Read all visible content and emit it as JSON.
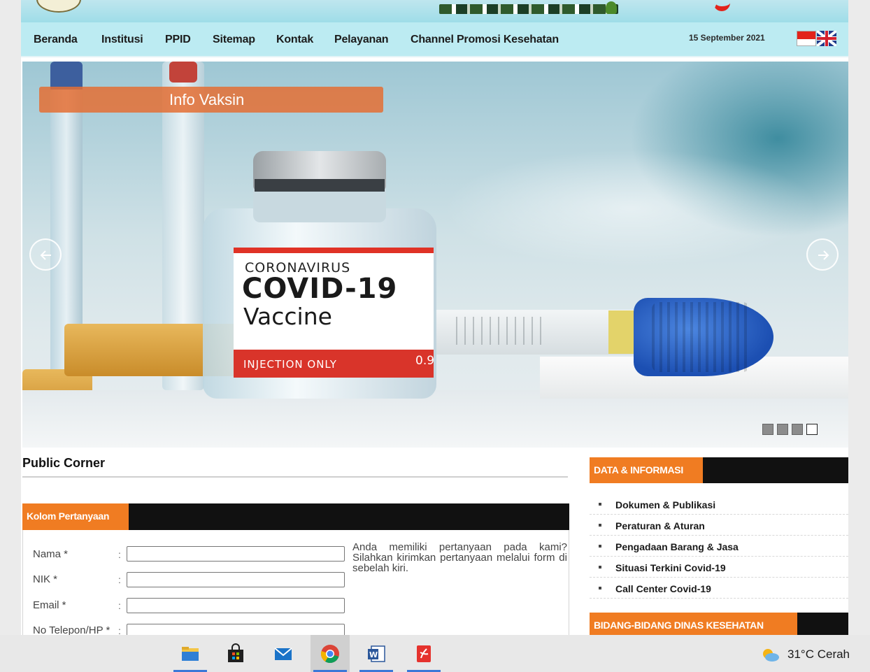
{
  "nav": {
    "items": [
      {
        "label": "Beranda"
      },
      {
        "label": "Institusi"
      },
      {
        "label": "PPID"
      },
      {
        "label": "Sitemap"
      },
      {
        "label": "Kontak"
      },
      {
        "label": "Pelayanan"
      },
      {
        "label": "Channel Promosi Kesehatan"
      }
    ],
    "date": "15 September 2021",
    "flags": [
      "flag-indonesia-icon",
      "flag-uk-icon"
    ]
  },
  "slider": {
    "caption": "Info Vaksin",
    "image_text": {
      "line1": "CORONAVIRUS",
      "line2": "COVID-19",
      "line3": "Vaccine",
      "line4": "INJECTION ONLY",
      "line5": "0.9"
    },
    "indicator_count": 4,
    "active_indicator": 3
  },
  "public_corner": {
    "title": "Public Corner",
    "form_title": "Kolom Pertanyaan",
    "fields": [
      {
        "label": "Nama *",
        "value": ""
      },
      {
        "label": "NIK *",
        "value": ""
      },
      {
        "label": "Email *",
        "value": ""
      },
      {
        "label": "No Telepon/HP *",
        "value": ""
      }
    ],
    "colon": ":",
    "help_text": "Anda memiliki pertanyaan pada kami? Silahkan kirimkan pertanyaan melalui form di sebelah kiri."
  },
  "sidebar": {
    "data_heading": "DATA & INFORMASI",
    "data_items": [
      {
        "label": "Dokumen & Publikasi"
      },
      {
        "label": "Peraturan & Aturan"
      },
      {
        "label": "Pengadaan Barang & Jasa"
      },
      {
        "label": "Situasi Terkini Covid-19"
      },
      {
        "label": "Call Center Covid-19"
      }
    ],
    "bidang_heading": "BIDANG-BIDANG DINAS KESEHATAN"
  },
  "taskbar": {
    "apps": [
      "file-explorer-icon",
      "store-icon",
      "mail-icon",
      "chrome-icon",
      "word-icon",
      "acrobat-icon"
    ],
    "active_app": "chrome-icon",
    "weather": "31°C  Cerah"
  },
  "colors": {
    "accent_orange": "#f07c22",
    "nav_bg": "#bcebf2",
    "heading_bar": "#111111"
  }
}
